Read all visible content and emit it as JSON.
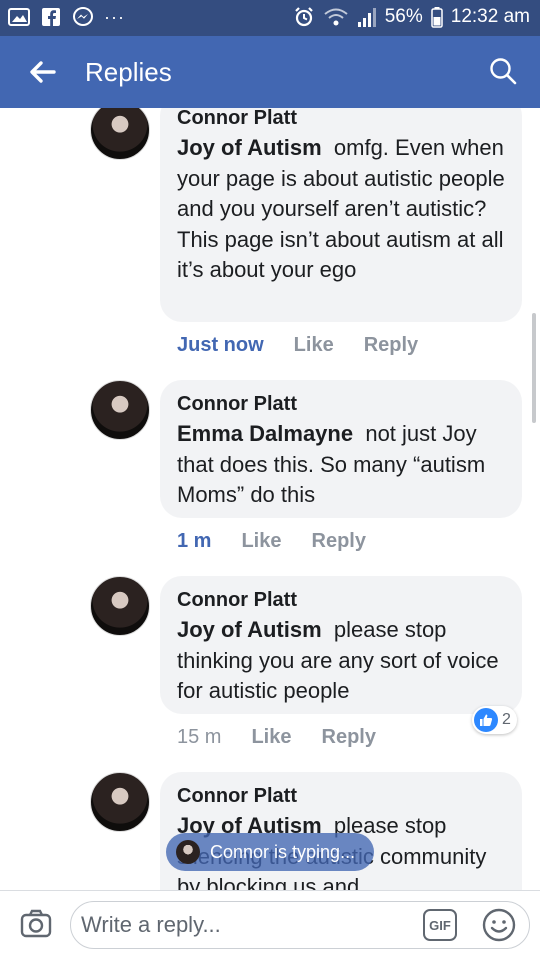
{
  "status_bar": {
    "battery": "56%",
    "time": "12:32 am",
    "dots": "···"
  },
  "app_bar": {
    "title": "Replies"
  },
  "comments": [
    {
      "author": "Connor Platt",
      "mention": "Joy of Autism",
      "text": "omfg. Even when your page is about autistic people and you yourself aren’t autistic? This page isn’t about autism at all it’s about your ego",
      "time": "Just now",
      "like": "Like",
      "reply": "Reply"
    },
    {
      "author": "Connor Platt",
      "mention": "Emma Dalmayne",
      "text": "not just Joy that does this. So many “autism Moms” do this",
      "time": "1 m",
      "like": "Like",
      "reply": "Reply"
    },
    {
      "author": "Connor Platt",
      "mention": "Joy of Autism",
      "text": "please stop thinking you are any sort of voice for autistic people",
      "time": "15 m",
      "like": "Like",
      "reply": "Reply",
      "reaction_count": "2"
    },
    {
      "author": "Connor Platt",
      "mention": "Joy of Autism",
      "text": "please stop silencing the autistic community by blocking us and"
    }
  ],
  "toast": {
    "text": "Connor is typing..."
  },
  "composer": {
    "placeholder": "Write a reply...",
    "gif_label": "GIF"
  },
  "colors": {
    "status_bar": "#344d80",
    "app_bar": "#4267b2",
    "bubble": "#f2f3f5",
    "link_blue": "#4267b2",
    "meta_gray": "#8d949e"
  },
  "icons": {
    "back": "arrow-left-icon",
    "search": "search-icon",
    "camera": "camera-icon",
    "emoji": "smiley-icon",
    "like_reaction": "thumbs-up-icon"
  }
}
